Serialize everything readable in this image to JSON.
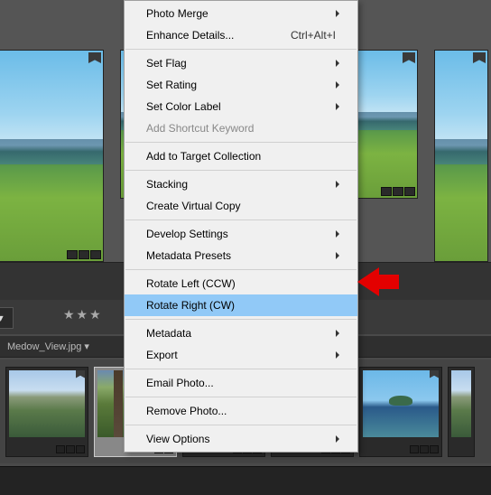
{
  "filename_bar": "Medow_View.jpg  ▾",
  "dropdown_label": "ne  ▾",
  "stars": "★★★",
  "menu": {
    "photo_merge": "Photo Merge",
    "enhance_details": "Enhance Details...",
    "enhance_details_shortcut": "Ctrl+Alt+I",
    "set_flag": "Set Flag",
    "set_rating": "Set Rating",
    "set_color_label": "Set Color Label",
    "add_shortcut_keyword": "Add Shortcut Keyword",
    "add_to_target": "Add to Target Collection",
    "stacking": "Stacking",
    "create_virtual_copy": "Create Virtual Copy",
    "develop_settings": "Develop Settings",
    "metadata_presets": "Metadata Presets",
    "rotate_left": "Rotate Left (CCW)",
    "rotate_right": "Rotate Right (CW)",
    "metadata": "Metadata",
    "export": "Export",
    "email_photo": "Email Photo...",
    "remove_photo": "Remove Photo...",
    "view_options": "View Options"
  }
}
